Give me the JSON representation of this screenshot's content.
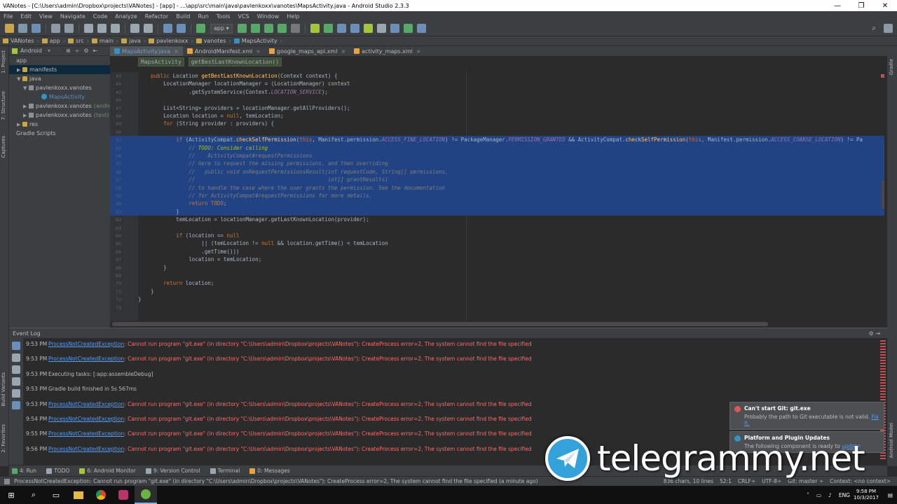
{
  "window": {
    "title": "VANotes - [C:\\Users\\admin\\Dropbox\\projects\\VANotes] - [app] - ...\\app\\src\\main\\java\\pavlenkoxx\\vanotes\\MapsActivity.java - Android Studio 2.3.3",
    "minimize": "—",
    "maximize": "❐",
    "close": "✕"
  },
  "menu": [
    "File",
    "Edit",
    "View",
    "Navigate",
    "Code",
    "Analyze",
    "Refactor",
    "Build",
    "Run",
    "Tools",
    "VCS",
    "Window",
    "Help"
  ],
  "toolbar": {
    "run_config": "app ▾"
  },
  "breadcrumbs": [
    "VANotes",
    "app",
    "src",
    "main",
    "java",
    "pavlenkoxx",
    "vanotes",
    "MapsActivity"
  ],
  "project": {
    "view_selector": "Android",
    "items": [
      {
        "label": "app",
        "indent": 0,
        "kind": "none",
        "arrow": ""
      },
      {
        "label": "manifests",
        "indent": 1,
        "kind": "folder",
        "arrow": "▶",
        "selected": true
      },
      {
        "label": "java",
        "indent": 1,
        "kind": "folder",
        "arrow": "▼"
      },
      {
        "label": "pavlenkoxx.vanotes",
        "indent": 2,
        "kind": "pkg",
        "arrow": "▼"
      },
      {
        "label": "MapsActivity",
        "indent": 4,
        "kind": "class",
        "arrow": ""
      },
      {
        "label": "pavlenkoxx.vanotes",
        "suffix": "(androidTest)",
        "indent": 2,
        "kind": "pkg",
        "arrow": "▶"
      },
      {
        "label": "pavlenkoxx.vanotes",
        "suffix": "(test)",
        "indent": 2,
        "kind": "pkg",
        "arrow": "▶"
      },
      {
        "label": "res",
        "indent": 1,
        "kind": "folder",
        "arrow": "▶"
      },
      {
        "label": "Gradle Scripts",
        "indent": 0,
        "kind": "none",
        "arrow": ""
      }
    ]
  },
  "side_labels": {
    "project": "1: Project",
    "structure": "7: Structure",
    "captures": "Captures",
    "build_variants": "Build Variants",
    "favorites": "2: Favorites",
    "gradle": "Gradle",
    "android_model": "Android Model"
  },
  "editor": {
    "tabs": [
      {
        "label": "MapsActivity.java",
        "active": true,
        "color": "#3592c4"
      },
      {
        "label": "AndroidManifest.xml",
        "active": false,
        "color": "#e8a33d"
      },
      {
        "label": "google_maps_api.xml",
        "active": false,
        "color": "#e8a33d"
      },
      {
        "label": "activity_maps.xml",
        "active": false,
        "color": "#e8a33d"
      }
    ],
    "crumbs": [
      "MapsActivity",
      "getBestLastKnownLocation()"
    ],
    "lines": [
      {
        "n": "43",
        "hl": false,
        "html": "    <span class='kw'>public</span> Location <span class='fn'>getBestLastKnownLocation</span>(Context context) {"
      },
      {
        "n": "44",
        "hl": false,
        "html": "        LocationManager locationManager = (LocationManager) context"
      },
      {
        "n": "45",
        "hl": false,
        "html": "                .getSystemService(Context.<span class='cn'>LOCATION_SERVICE</span>);"
      },
      {
        "n": "46",
        "hl": false,
        "html": ""
      },
      {
        "n": "47",
        "hl": false,
        "html": "        List&lt;String&gt; providers = locationManager.getAllProviders();"
      },
      {
        "n": "48",
        "hl": false,
        "html": "        Location location = <span class='kw'>null</span>, temLocation;"
      },
      {
        "n": "49",
        "hl": false,
        "html": "        <span class='kw'>for</span> (String provider : providers) {"
      },
      {
        "n": "50",
        "hl": false,
        "html": ""
      },
      {
        "n": "52",
        "hl": true,
        "html": "            <span class='kw'>if</span> (ActivityCompat.<span class='fn'>checkSelfPermission</span>(<span class='kw'>this</span>, Manifest.permission.<span class='cn'>ACCESS_FINE_LOCATION</span>) != PackageManager.<span class='cn'>PERMISSION_GRANTED</span> &amp;&amp; ActivityCompat.<span class='fn'>checkSelfPermission</span>(<span class='kw'>this</span>, Manifest.permission.<span class='cn'>ACCESS_COARSE_LOCATION</span>) != Pa"
      },
      {
        "n": "53",
        "hl": true,
        "html": "                <span class='cm'>// </span><span class='td'>TODO: Consider calling</span>"
      },
      {
        "n": "54",
        "hl": true,
        "html": "                <span class='cm'>//    ActivityCompat#requestPermissions</span>"
      },
      {
        "n": "55",
        "hl": true,
        "html": "                <span class='cm'>// here to request the missing permissions, and then overriding</span>"
      },
      {
        "n": "56",
        "hl": true,
        "html": "                <span class='cm'>//   public void onRequestPermissionsResult(int requestCode, String[] permissions,</span>"
      },
      {
        "n": "57",
        "hl": true,
        "html": "                <span class='cm'>//                                          int[] grantResults)</span>"
      },
      {
        "n": "58",
        "hl": true,
        "html": "                <span class='cm'>// to handle the case where the user grants the permission. See the documentation</span>"
      },
      {
        "n": "59",
        "hl": true,
        "html": "                <span class='cm'>// for ActivityCompat#requestPermissions for more details.</span>"
      },
      {
        "n": "60",
        "hl": true,
        "html": "                <span class='kw'>return</span> <span class='kw'>TODO</span>;"
      },
      {
        "n": "61",
        "hl": true,
        "html": "            }"
      },
      {
        "n": "62",
        "hl": false,
        "html": "            temLocation = locationManager.getLastKnownLocation(provider);"
      },
      {
        "n": "63",
        "hl": false,
        "html": ""
      },
      {
        "n": "64",
        "hl": false,
        "html": "            <span class='kw'>if</span> (location == <span class='kw'>null</span>"
      },
      {
        "n": "65",
        "hl": false,
        "html": "                    || (temLocation != <span class='kw'>null</span> &amp;&amp; location.getTime() &lt; temLocation"
      },
      {
        "n": "66",
        "hl": false,
        "html": "                    .getTime()))"
      },
      {
        "n": "67",
        "hl": false,
        "html": "                location = temLocation;"
      },
      {
        "n": "68",
        "hl": false,
        "html": "        }"
      },
      {
        "n": "69",
        "hl": false,
        "html": ""
      },
      {
        "n": "70",
        "hl": false,
        "html": "        <span class='kw'>return</span> location;"
      },
      {
        "n": "71",
        "hl": false,
        "html": "    }"
      },
      {
        "n": "72",
        "hl": false,
        "html": "}"
      },
      {
        "n": "73",
        "hl": false,
        "html": ""
      }
    ]
  },
  "event_log": {
    "title": "Event Log",
    "rows": [
      {
        "time": "9:53 PM",
        "link": "ProcessNotCreatedException",
        "text": ": Cannot run program \"git.exe\" (in directory \"C:\\Users\\admin\\Dropbox\\projects\\VANotes\"): CreateProcess error=2, The system cannot find the file specified",
        "err": true
      },
      {
        "time": "9:53 PM",
        "link": "ProcessNotCreatedException",
        "text": ": Cannot run program \"git.exe\" (in directory \"C:\\Users\\admin\\Dropbox\\projects\\VANotes\"): CreateProcess error=2, The system cannot find the file specified",
        "err": true
      },
      {
        "time": "9:53 PM",
        "link": "",
        "text": "Executing tasks: [:app:assembleDebug]",
        "err": false
      },
      {
        "time": "9:53 PM",
        "link": "",
        "text": "Gradle build finished in 5s 567ms",
        "err": false
      },
      {
        "time": "9:53 PM",
        "link": "ProcessNotCreatedException",
        "text": ": Cannot run program \"git.exe\" (in directory \"C:\\Users\\admin\\Dropbox\\projects\\VANotes\"): CreateProcess error=2, The system cannot find the file specified",
        "err": true
      },
      {
        "time": "9:54 PM",
        "link": "ProcessNotCreatedException",
        "text": ": Cannot run program \"git.exe\" (in directory \"C:\\Users\\admin\\Dropbox\\projects\\VANotes\"): CreateProcess error=2, The system cannot find the file specified",
        "err": true
      },
      {
        "time": "9:55 PM",
        "link": "ProcessNotCreatedException",
        "text": ": Cannot run program \"git.exe\" (in directory \"C:\\Users\\admin\\Dropbox\\projects\\VANotes\"): CreateProcess error=2, The system cannot find the file specified",
        "err": true
      },
      {
        "time": "9:56 PM",
        "link": "ProcessNotCreatedException",
        "text": ": Cannot run program \"git.exe\" (in directory \"C:\\Users\\admin\\Dropbox\\projects\\VANotes\"): CreateProcess error=2, The system cannot find the file specified",
        "err": true
      }
    ]
  },
  "notifications": [
    {
      "title": "Can't start Git: git.exe",
      "body": "Probably the path to Git executable is not valid.",
      "link": "Fix it.",
      "color": "#e05555"
    },
    {
      "title": "Platform and Plugin Updates",
      "body": "The following component is ready to",
      "link": "update",
      "color": "#3592c4"
    }
  ],
  "bottom_tabs": [
    {
      "label": "4: Run",
      "color": "#59a869"
    },
    {
      "label": "TODO",
      "color": "#9aa7b0"
    },
    {
      "label": "6: Android Monitor",
      "color": "#a4c639"
    },
    {
      "label": "9: Version Control",
      "color": "#9aa7b0"
    },
    {
      "label": "Terminal",
      "color": "#9aa7b0"
    },
    {
      "label": "0: Messages",
      "color": "#e8a33d"
    }
  ],
  "status": {
    "message": "ProcessNotCreatedException: Cannot run program \"git.exe\" (in directory \"C:\\Users\\admin\\Dropbox\\projects\\VANotes\"): CreateProcess error=2, The system cannot find the file specified (a minute ago)",
    "chars": "836 chars, 10 lines",
    "pos": "52:1",
    "crlf": "CRLF÷",
    "enc": "UTF-8÷",
    "git": "Git: master ÷",
    "context": "Context: <no context>"
  },
  "taskbar": {
    "lang": "ENG",
    "time": "9:58 PM",
    "date": "10/3/2017"
  },
  "watermark": {
    "text": "telegrammy.net"
  }
}
